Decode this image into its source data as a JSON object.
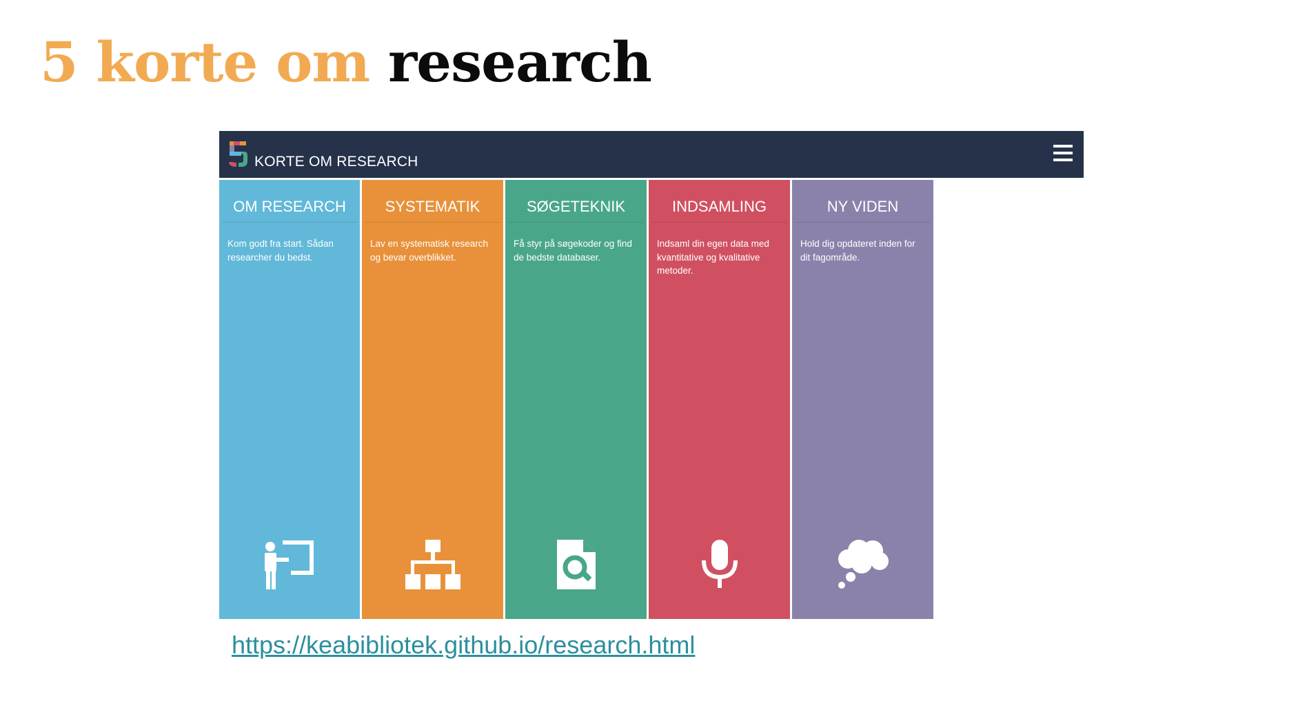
{
  "slide": {
    "title_accent": "5 korte om",
    "title_main": "research",
    "link": "https://keabibliotek.github.io/research.html"
  },
  "app": {
    "brand": "KORTE OM RESEARCH",
    "logo_numeral": "5",
    "navbar_color": "#25324a"
  },
  "columns": [
    {
      "title": "OM RESEARCH",
      "description": "Kom godt fra start. Sådan researcher du bedst.",
      "icon": "presenter-board-icon",
      "color": "#62b8d9"
    },
    {
      "title": "SYSTEMATIK",
      "description": "Lav en systematisk research og bevar overblikket.",
      "icon": "sitemap-icon",
      "color": "#e8913a"
    },
    {
      "title": "SØGETEKNIK",
      "description": "Få styr på søgekoder og find de bedste databaser.",
      "icon": "file-search-icon",
      "color": "#4aa68a"
    },
    {
      "title": "INDSAMLING",
      "description": "Indsaml din egen data med kvantitative og kvalitative metoder.",
      "icon": "microphone-icon",
      "color": "#d05061"
    },
    {
      "title": "NY VIDEN",
      "description": "Hold dig opdateret inden for dit fagområde.",
      "icon": "thought-cloud-icon",
      "color": "#8b82ab"
    }
  ]
}
